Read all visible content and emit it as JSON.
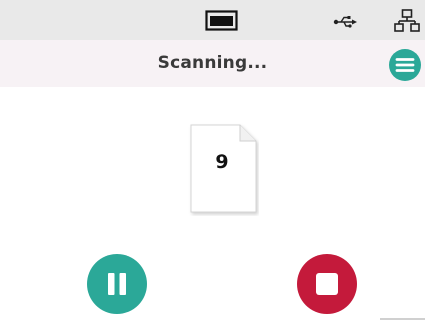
{
  "status_bar": {
    "icons": [
      "scanner-icon",
      "usb-icon",
      "network-icon"
    ]
  },
  "header": {
    "title": "Scanning...",
    "menu_icon": "hamburger-menu-icon"
  },
  "scan": {
    "page_count": "9"
  },
  "controls": {
    "pause_icon": "pause-icon",
    "stop_icon": "stop-icon"
  },
  "colors": {
    "accent": "#2ba898",
    "stop": "#c41a3b",
    "status_bar_bg": "#e9e9e9",
    "header_bg": "#f7f2f5"
  }
}
